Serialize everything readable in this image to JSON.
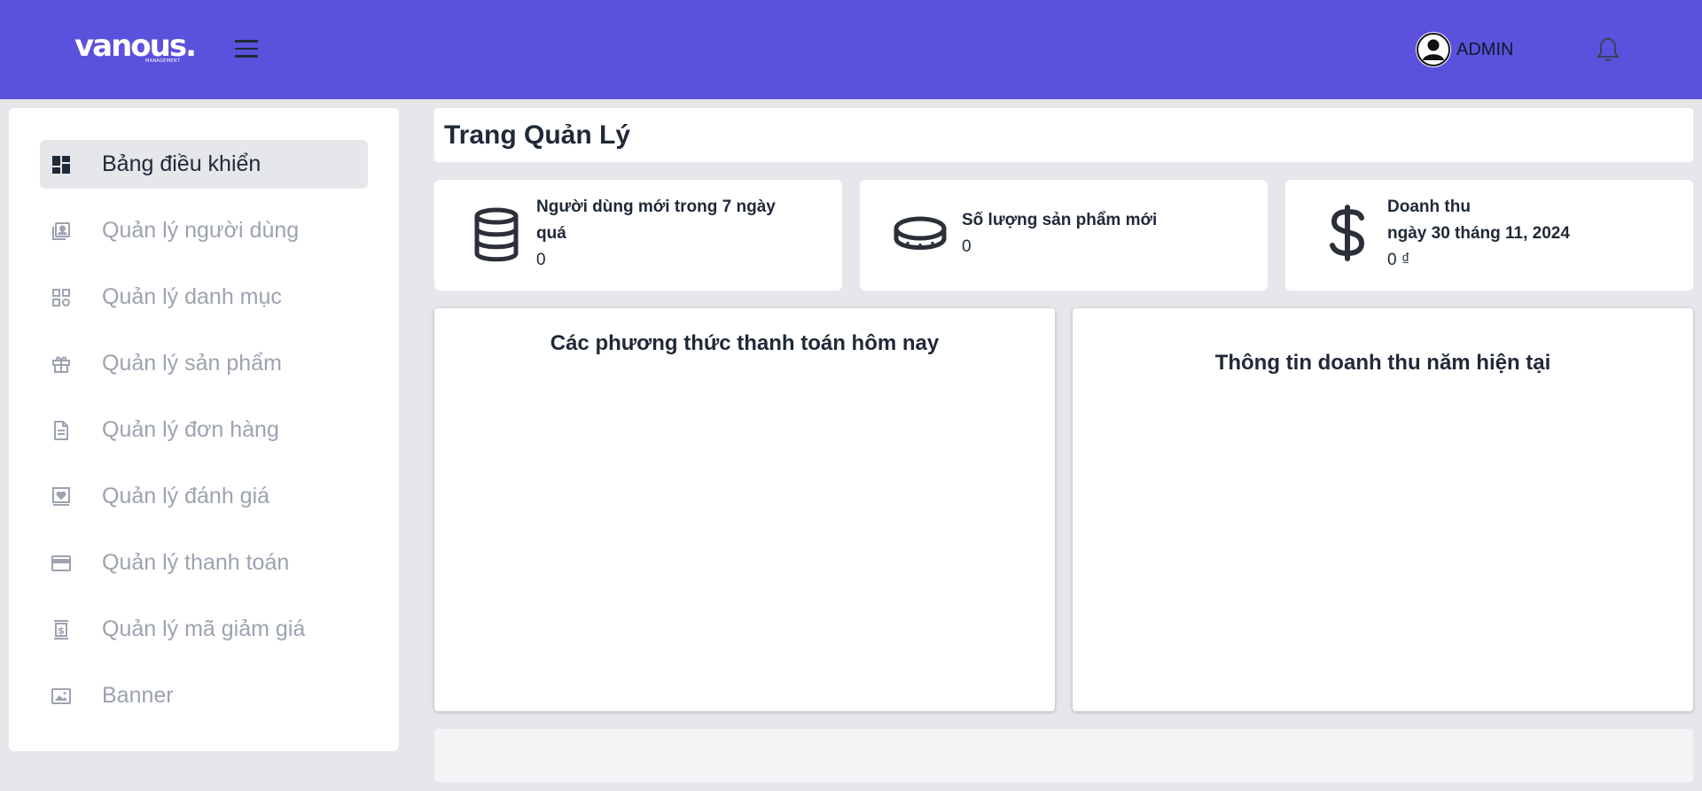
{
  "header": {
    "logo": "vanous.",
    "logo_sub": "MANAGEMENT",
    "menu_icon": "hamburger-icon",
    "user_label": "ADMIN",
    "user_icon": "user-circle-icon",
    "bell_icon": "bell-icon",
    "accent": "#5a52dc"
  },
  "sidebar": {
    "items": [
      {
        "label": "Bảng điều khiển",
        "icon": "dashboard-icon",
        "active": true
      },
      {
        "label": "Quản lý người dùng",
        "icon": "user-card-icon"
      },
      {
        "label": "Quản lý danh mục",
        "icon": "category-icon"
      },
      {
        "label": "Quản lý sản phẩm",
        "icon": "gift-icon"
      },
      {
        "label": "Quản lý đơn hàng",
        "icon": "document-icon"
      },
      {
        "label": "Quản lý đánh giá",
        "icon": "heart-card-icon"
      },
      {
        "label": "Quản lý thanh toán",
        "icon": "credit-card-icon"
      },
      {
        "label": "Quản lý mã giảm giá",
        "icon": "voucher-icon"
      },
      {
        "label": "Banner",
        "icon": "image-icon"
      }
    ]
  },
  "main": {
    "title": "Trang Quản Lý",
    "stats": [
      {
        "title": "Người dùng mới trong 7 ngày\nquá",
        "value": "0",
        "icon": "database-icon"
      },
      {
        "title": "Số lượng sản phẩm mới",
        "value": "0",
        "icon": "coin-icon"
      },
      {
        "title": "Doanh thu\nngày 30 tháng 11, 2024",
        "value": "0 ₫",
        "icon": "dollar-icon"
      }
    ],
    "panels": [
      {
        "title": "Các phương thức thanh toán hôm nay"
      },
      {
        "title": "Thông tin doanh thu năm hiện tại"
      }
    ]
  }
}
